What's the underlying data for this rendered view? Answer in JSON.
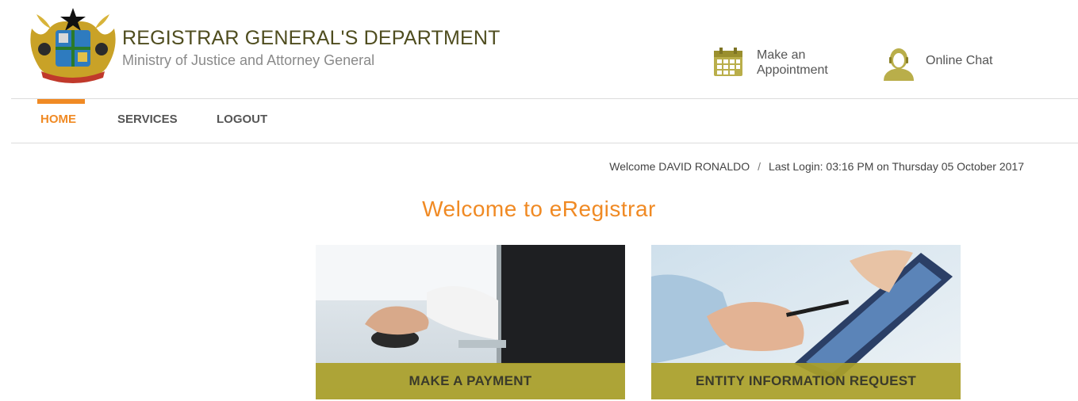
{
  "header": {
    "org_title": "REGISTRAR GENERAL'S DEPARTMENT",
    "org_subtitle": "Ministry of Justice and Attorney General",
    "crest_icon": "ghana-coat-of-arms-icon",
    "appointment_label": "Make an Appointment",
    "appointment_icon": "calendar-icon",
    "chat_label": "Online Chat",
    "chat_icon": "support-agent-icon"
  },
  "nav": {
    "items": [
      {
        "label": "HOME",
        "active": true
      },
      {
        "label": "SERVICES",
        "active": false
      },
      {
        "label": "LOGOUT",
        "active": false
      }
    ]
  },
  "user": {
    "welcome": "Welcome DAVID RONALDO",
    "separator": "/",
    "last_login": "Last Login: 03:16 PM on Thursday 05 October 2017"
  },
  "main": {
    "title": "Welcome to eRegistrar",
    "tiles": [
      {
        "label": "MAKE A PAYMENT"
      },
      {
        "label": "ENTITY INFORMATION REQUEST"
      }
    ]
  },
  "colors": {
    "accent": "#f08a24",
    "olive": "#aaa028",
    "title_text": "#4f4d1f"
  }
}
